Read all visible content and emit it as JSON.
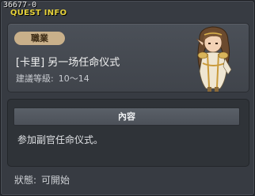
{
  "window": {
    "quest_id": "36677-0",
    "title": "QUEST INFO"
  },
  "info": {
    "job_label": "職業",
    "quest_name": "[卡里] 另一场任命仪式",
    "level_label": "建議等級:",
    "level_value": "10～14",
    "npc_icon": "npc-portrait-elf"
  },
  "content": {
    "header": "內容",
    "text": "参加副官任命仪式。"
  },
  "status": {
    "label": "狀態:",
    "value": "可開始"
  },
  "colors": {
    "title_yellow": "#e6d23a",
    "badge": "#c9b08a",
    "panel": "#373b42"
  }
}
